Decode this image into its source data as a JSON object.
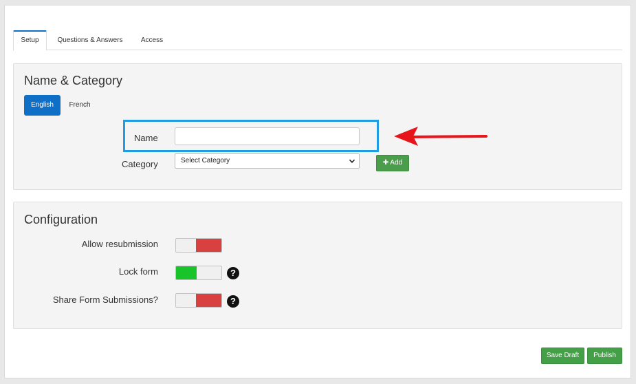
{
  "tabs": [
    {
      "label": "Setup",
      "active": true
    },
    {
      "label": "Questions & Answers",
      "active": false
    },
    {
      "label": "Access",
      "active": false
    }
  ],
  "name_category": {
    "title": "Name & Category",
    "languages": [
      "English",
      "French"
    ],
    "name_label": "Name",
    "name_value": "",
    "category_label": "Category",
    "category_selected": "Select Category",
    "add_label": "Add"
  },
  "configuration": {
    "title": "Configuration",
    "options": [
      {
        "label": "Allow resubmission",
        "state": "off",
        "help": false
      },
      {
        "label": "Lock form",
        "state": "on",
        "help": true
      },
      {
        "label": "Share Form Submissions?",
        "state": "off",
        "help": true
      }
    ]
  },
  "footer": {
    "save_draft": "Save Draft",
    "publish": "Publish"
  },
  "colors": {
    "primary": "#0f6fc6",
    "success": "#43a047",
    "toggle_off": "#d94040",
    "toggle_on": "#19c42a",
    "highlight": "#1e9de3",
    "annotation_arrow": "#e8141b"
  }
}
